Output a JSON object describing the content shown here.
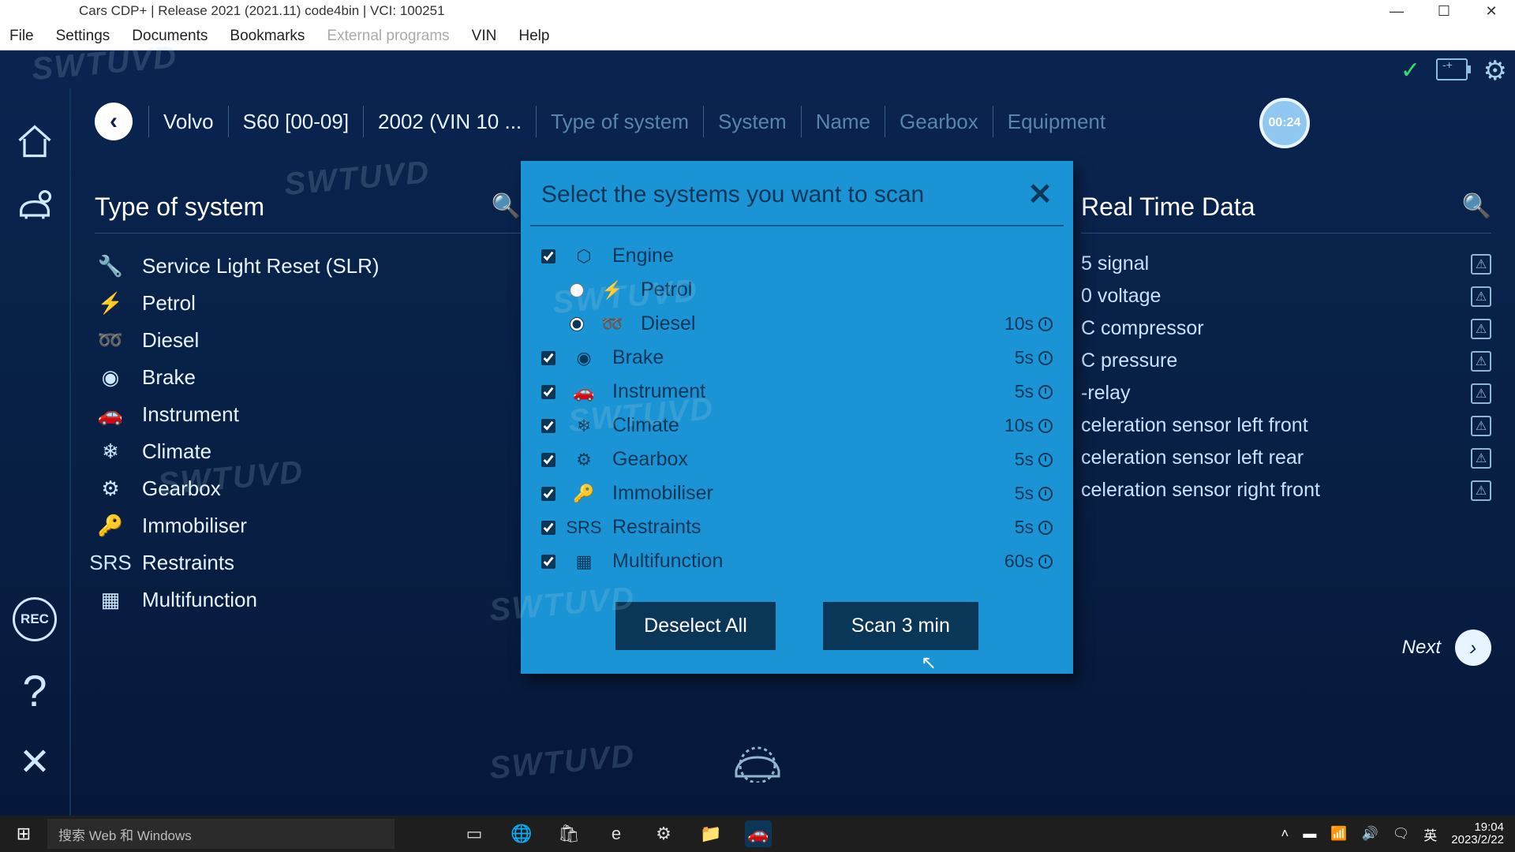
{
  "title_bar": "Cars CDP+  |  Release 2021 (2021.11) code4bin  |  VCI: 100251",
  "window_controls": {
    "min": "—",
    "max": "☐",
    "close": "✕"
  },
  "menu": {
    "file": "File",
    "settings": "Settings",
    "documents": "Documents",
    "bookmarks": "Bookmarks",
    "external": "External programs",
    "vin": "VIN",
    "help": "Help"
  },
  "breadcrumb": {
    "items": [
      {
        "label": "Volvo",
        "active": true
      },
      {
        "label": "S60 [00-09]",
        "active": true
      },
      {
        "label": "2002 (VIN 10 ...",
        "active": true
      },
      {
        "label": "Type of system",
        "active": false
      },
      {
        "label": "System",
        "active": false
      },
      {
        "label": "Name",
        "active": false
      },
      {
        "label": "Gearbox",
        "active": false
      },
      {
        "label": "Equipment",
        "active": false
      }
    ]
  },
  "timer": "00:24",
  "left_panel": {
    "title": "Type of system",
    "items": [
      {
        "icon": "🔧",
        "label": "Service Light Reset (SLR)"
      },
      {
        "icon": "⚡",
        "label": "Petrol"
      },
      {
        "icon": "➿",
        "label": "Diesel"
      },
      {
        "icon": "◉",
        "label": "Brake"
      },
      {
        "icon": "🚗",
        "label": "Instrument"
      },
      {
        "icon": "❄",
        "label": "Climate"
      },
      {
        "icon": "⚙",
        "label": "Gearbox"
      },
      {
        "icon": "🔑",
        "label": "Immobiliser"
      },
      {
        "icon": "SRS",
        "label": "Restraints"
      },
      {
        "icon": "▦",
        "label": "Multifunction"
      }
    ]
  },
  "right_panel": {
    "title": "Real Time Data",
    "items": [
      "5 signal",
      "0 voltage",
      "C compressor",
      "C pressure",
      "-relay",
      "celeration sensor left front",
      "celeration sensor left rear",
      "celeration sensor right front"
    ],
    "next": "Next"
  },
  "modal": {
    "title": "Select the systems you want to scan",
    "rows": [
      {
        "type": "check",
        "checked": true,
        "icon": "⬡",
        "label": "Engine",
        "time": ""
      },
      {
        "type": "radio",
        "checked": false,
        "icon": "⚡",
        "label": "Petrol",
        "time": "",
        "indent": true
      },
      {
        "type": "radio",
        "checked": true,
        "icon": "➿",
        "label": "Diesel",
        "time": "10s",
        "indent": true
      },
      {
        "type": "check",
        "checked": true,
        "icon": "◉",
        "label": "Brake",
        "time": "5s"
      },
      {
        "type": "check",
        "checked": true,
        "icon": "🚗",
        "label": "Instrument",
        "time": "5s"
      },
      {
        "type": "check",
        "checked": true,
        "icon": "❄",
        "label": "Climate",
        "time": "10s"
      },
      {
        "type": "check",
        "checked": true,
        "icon": "⚙",
        "label": "Gearbox",
        "time": "5s"
      },
      {
        "type": "check",
        "checked": true,
        "icon": "🔑",
        "label": "Immobiliser",
        "time": "5s"
      },
      {
        "type": "check",
        "checked": true,
        "icon": "SRS",
        "label": "Restraints",
        "time": "5s"
      },
      {
        "type": "check",
        "checked": true,
        "icon": "▦",
        "label": "Multifunction",
        "time": "60s"
      }
    ],
    "deselect": "Deselect All",
    "scan": "Scan 3 min"
  },
  "sidebar_rec": "REC",
  "taskbar": {
    "search_placeholder": "搜索 Web 和 Windows",
    "time": "19:04",
    "date": "2023/2/22",
    "ime": "英"
  },
  "watermark": "SWTUVD"
}
